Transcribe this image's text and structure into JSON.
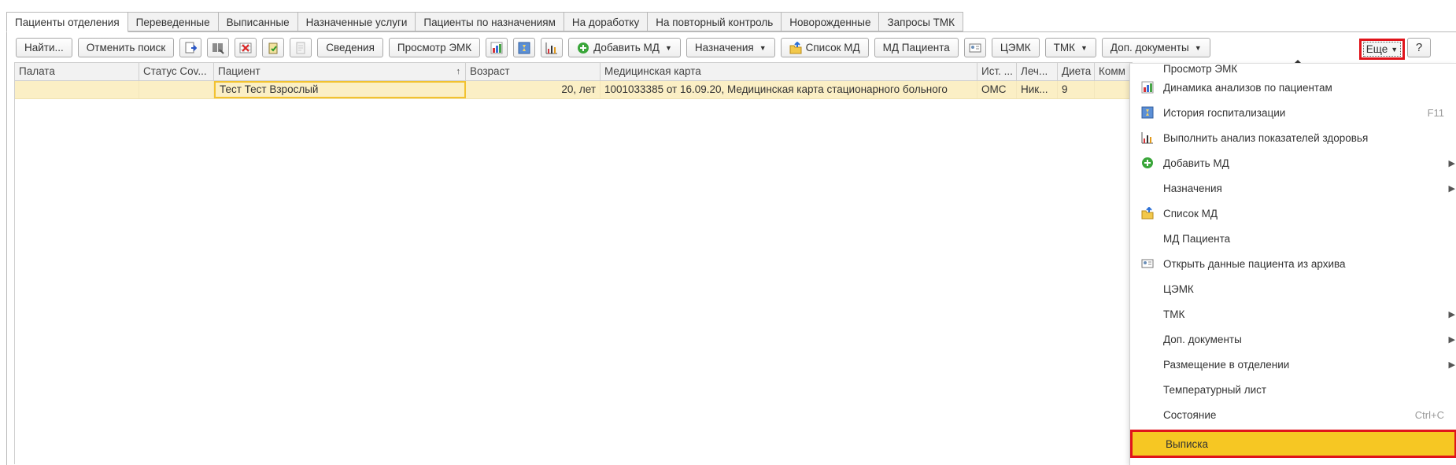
{
  "tabs": [
    {
      "label": "Пациенты отделения",
      "active": true
    },
    {
      "label": "Переведенные"
    },
    {
      "label": "Выписанные"
    },
    {
      "label": "Назначенные услуги"
    },
    {
      "label": "Пациенты по назначениям"
    },
    {
      "label": "На доработку"
    },
    {
      "label": "На повторный контроль"
    },
    {
      "label": "Новорожденные"
    },
    {
      "label": "Запросы ТМК"
    }
  ],
  "toolbar": {
    "find": "Найти...",
    "cancel_search": "Отменить поиск",
    "info": "Сведения",
    "view_emk": "Просмотр ЭМК",
    "add_md": "Добавить МД",
    "assignments": "Назначения",
    "md_list": "Список МД",
    "patient_md": "МД Пациента",
    "cemk": "ЦЭМК",
    "tmk": "ТМК",
    "extra_docs": "Доп. документы",
    "more": "Еще",
    "help": "?"
  },
  "table": {
    "columns": [
      "Палата",
      "Статус Cov...",
      "Пациент",
      "Возраст",
      "Медицинская карта",
      "Ист. ...",
      "Леч...",
      "Диета",
      "Комм"
    ],
    "sort_indicator": "↑",
    "rows": [
      {
        "ward": "",
        "status": "",
        "patient": "Тест Тест Взрослый",
        "age": "20, лет",
        "card": "1001033385 от 16.09.20, Медицинская карта стационарного больного",
        "source": "ОМС",
        "doctor": "Ник...",
        "diet": "9",
        "comment": ""
      }
    ]
  },
  "menu": {
    "items": [
      {
        "label": "Просмотр ЭМК",
        "partial": true
      },
      {
        "label": "Динамика анализов по пациентам",
        "icon": "analysis-dynamics-icon"
      },
      {
        "label": "История госпитализации",
        "icon": "hospitalization-history-icon",
        "shortcut": "F11"
      },
      {
        "label": "Выполнить анализ показателей здоровья",
        "icon": "bar-chart-icon"
      },
      {
        "label": "Добавить МД",
        "icon": "add-circle-icon",
        "submenu": true
      },
      {
        "label": "Назначения",
        "submenu": true
      },
      {
        "label": "Список МД",
        "icon": "folder-up-icon"
      },
      {
        "label": "МД Пациента"
      },
      {
        "label": "Открыть данные пациента из архива",
        "icon": "id-card-icon"
      },
      {
        "label": "ЦЭМК"
      },
      {
        "label": "ТМК",
        "submenu": true
      },
      {
        "label": "Доп. документы",
        "submenu": true
      },
      {
        "label": "Размещение в отделении",
        "submenu": true
      },
      {
        "label": "Температурный лист"
      },
      {
        "label": "Состояние",
        "shortcut": "Ctrl+C"
      },
      {
        "label": "Выписка",
        "selected": true
      }
    ]
  },
  "colors": {
    "row_highlight": "#fbefc5",
    "focus_border": "#f2c230",
    "selected_item": "#f6c723",
    "callout_red": "#e0141b"
  }
}
